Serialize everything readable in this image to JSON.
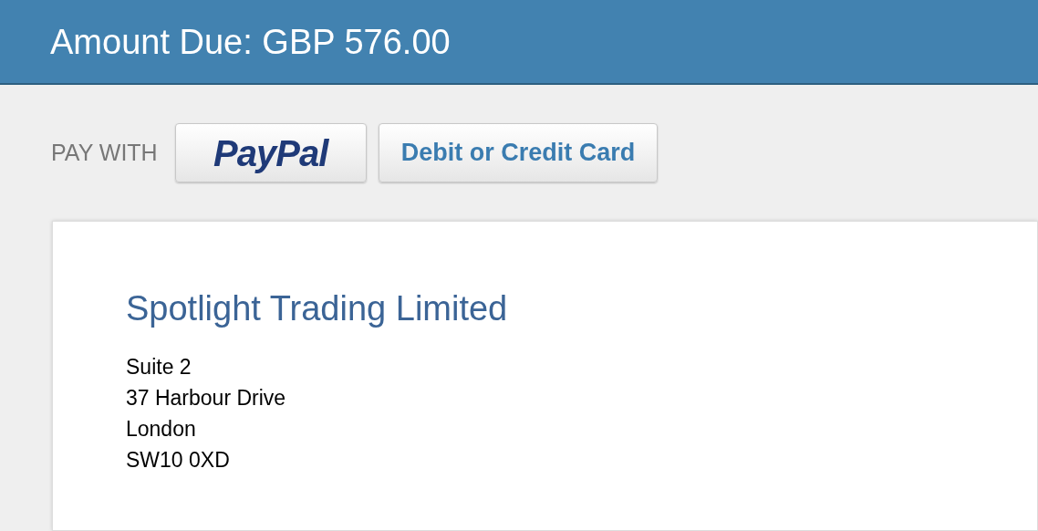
{
  "header": {
    "title": "Amount Due: GBP 576.00"
  },
  "payment": {
    "label": "PAY WITH",
    "options": [
      {
        "kind": "logo",
        "label": "PayPal"
      },
      {
        "kind": "text",
        "label": "Debit or Credit Card"
      }
    ]
  },
  "merchant": {
    "name": "Spotlight Trading Limited",
    "address": [
      "Suite 2",
      "37 Harbour Drive",
      "London",
      "SW10 0XD"
    ]
  }
}
